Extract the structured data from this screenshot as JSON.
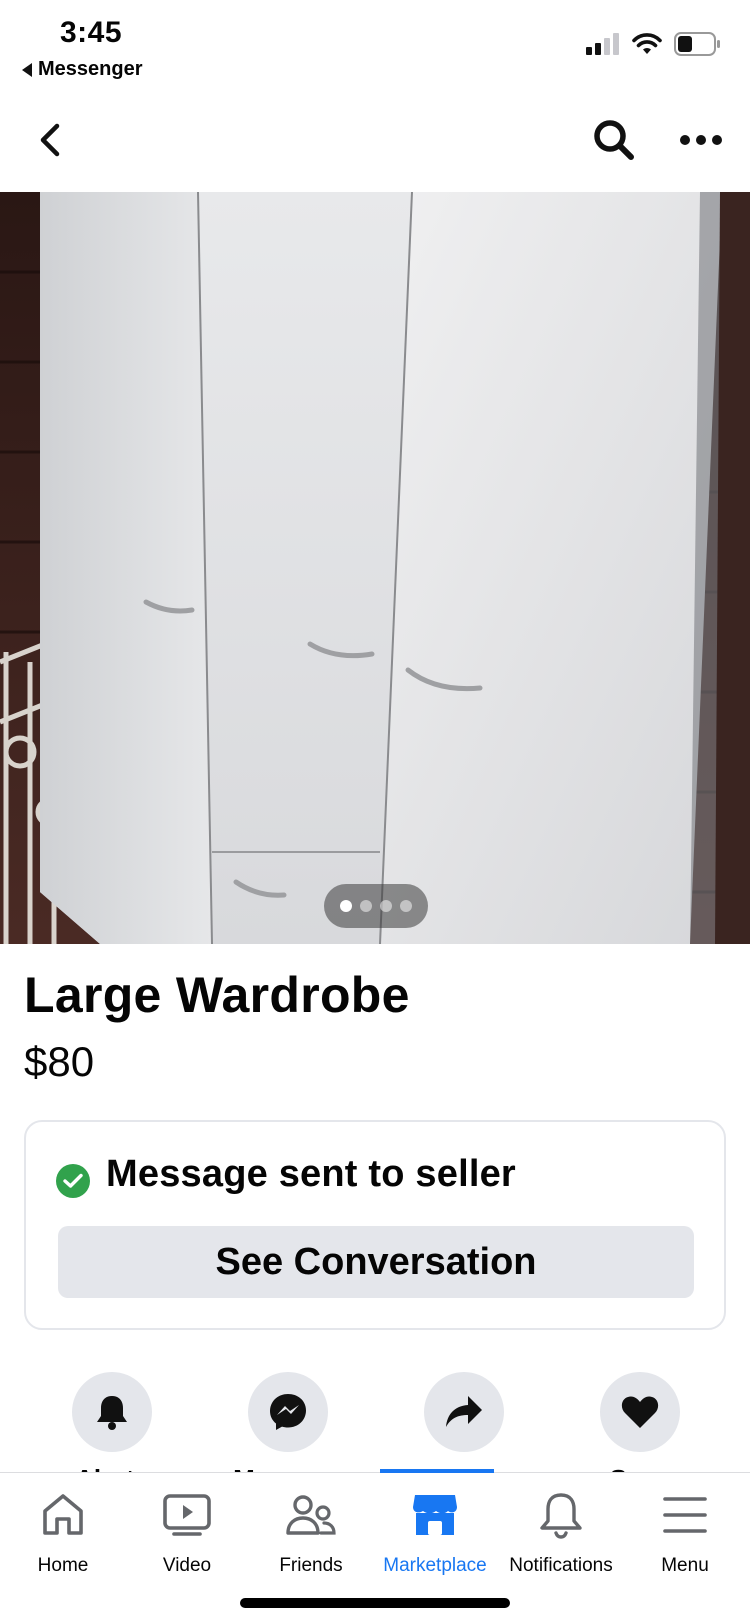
{
  "status_bar": {
    "time": "3:45",
    "back_app_label": "Messenger",
    "icons": [
      "cellular-signal-icon",
      "wifi-icon",
      "battery-icon"
    ]
  },
  "nav": {
    "icons": [
      "back-chevron-icon",
      "search-icon",
      "more-icon"
    ]
  },
  "gallery": {
    "photo_count": 4,
    "active_index": 0
  },
  "listing": {
    "title": "Large Wardrobe",
    "price": "$80"
  },
  "message_card": {
    "status_text": "Message sent to seller",
    "button_label": "See Conversation",
    "status_color": "#31a24c"
  },
  "actions": [
    {
      "icon": "bell-icon",
      "label": "Alerts"
    },
    {
      "icon": "messenger-icon",
      "label": "Message"
    },
    {
      "icon": "share-icon",
      "label": "Share"
    },
    {
      "icon": "heart-icon",
      "label": "Save"
    }
  ],
  "tab_bar": {
    "tabs": [
      {
        "label": "Home",
        "icon": "home-icon"
      },
      {
        "label": "Video",
        "icon": "video-icon"
      },
      {
        "label": "Friends",
        "icon": "friends-icon"
      },
      {
        "label": "Marketplace",
        "icon": "marketplace-icon"
      },
      {
        "label": "Notifications",
        "icon": "bell-outline-icon"
      },
      {
        "label": "Menu",
        "icon": "hamburger-menu-icon"
      }
    ],
    "active_tab": "Marketplace",
    "accent_color": "#1877f2"
  }
}
